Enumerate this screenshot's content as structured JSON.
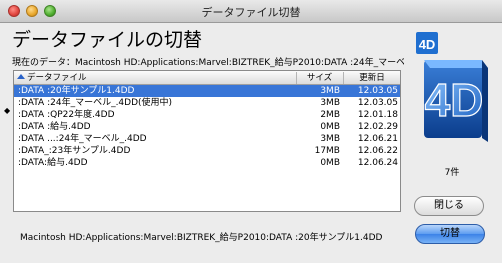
{
  "window": {
    "title": "データファイル切替"
  },
  "heading": "データファイルの切替",
  "current_data": "現在のデータ：Macintosh HD:Applications:Marvel:BIZTREK_給与P2010:DATA :24年_マーベ",
  "table": {
    "headers": {
      "file": "データファイル",
      "size": "サイズ",
      "date": "更新日"
    },
    "rows": [
      {
        "file": ":DATA :20年サンプル1.4DD",
        "size": "3MB",
        "date": "12.03.05"
      },
      {
        "file": ":DATA :24年_マーベル_.4DD(使用中)",
        "size": "3MB",
        "date": "12.03.05"
      },
      {
        "file": ":DATA :QP22年度.4DD",
        "size": "2MB",
        "date": "12.01.18"
      },
      {
        "file": ":DATA :給与.4DD",
        "size": "0MB",
        "date": "12.02.29"
      },
      {
        "file": ":DATA ...:24年_マーベル_.4DD",
        "size": "3MB",
        "date": "12.06.21"
      },
      {
        "file": ":DATA_:23年サンプル.4DD",
        "size": "17MB",
        "date": "12.06.22"
      },
      {
        "file": ":DATA:給与.4DD",
        "size": "0MB",
        "date": "12.06.24"
      }
    ],
    "in_use_marker": "◆"
  },
  "logo_label": "4D",
  "count_label": "7件",
  "close_button": "閉じる",
  "switch_button": "切替",
  "selected_path": "Macintosh HD:Applications:Marvel:BIZTREK_給与P2010:DATA :20年サンプル1.4DD",
  "colors": {
    "selection": "#3875d7",
    "accent_button": "#5d9cf0"
  }
}
